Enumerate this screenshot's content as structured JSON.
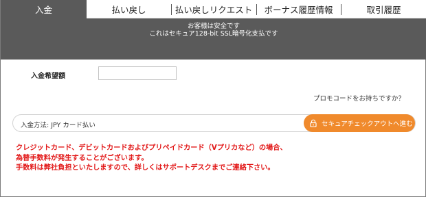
{
  "tabs": [
    {
      "label": "入金",
      "active": true
    },
    {
      "label": "払い戻し",
      "active": false
    },
    {
      "label": "払い戻しリクエスト",
      "active": false
    },
    {
      "label": "ボーナス履歴情報",
      "active": false
    },
    {
      "label": "取引履歴",
      "active": false
    }
  ],
  "banner": {
    "line1": "お客様は安全です",
    "line2": "これはセキュア128-bit SSL暗号化支払です"
  },
  "amount": {
    "label": "入金希望額",
    "value": "",
    "placeholder": ""
  },
  "promo_link": "プロモコードをお持ちですか？",
  "payment": {
    "method_label": "入金方法: JPY カード払い",
    "checkout_button": "セキュアチェックアウトへ進む",
    "checkout_icon": "lock-icon"
  },
  "warning": {
    "lines": [
      "クレジットカード、デビットカードおよびプリペイドカード（Vプリカなど）の場合、",
      "為替手数料が発生することがございます。",
      "手数料は弊社負担といたしますので、詳しくはサポートデスクまでご連絡下さい。"
    ]
  },
  "colors": {
    "banner_bg": "#5a5a5a",
    "accent_orange": "#f08a2c",
    "warning_red": "#e21818"
  }
}
